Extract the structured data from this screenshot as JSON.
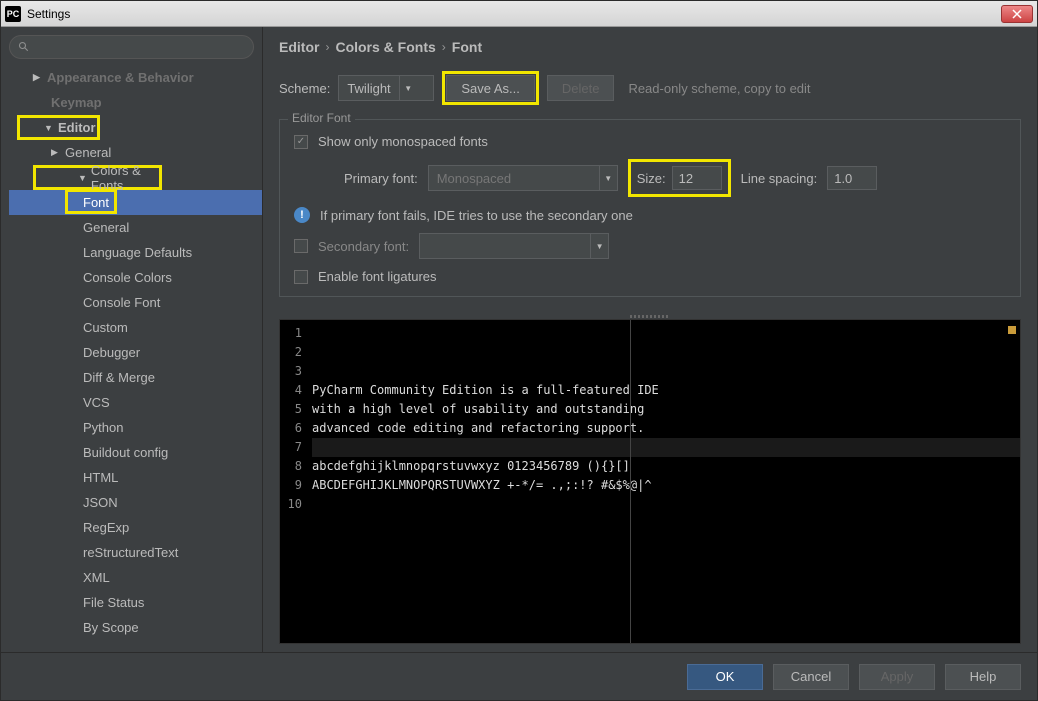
{
  "window_title": "Settings",
  "app_icon_text": "PC",
  "search_placeholder": "",
  "tree": {
    "appearance": "Appearance & Behavior",
    "keymap": "Keymap",
    "editor": "Editor",
    "general": "General",
    "colors_fonts": "Colors & Fonts",
    "font": "Font",
    "cf_general": "General",
    "lang_defaults": "Language Defaults",
    "console_colors": "Console Colors",
    "console_font": "Console Font",
    "custom": "Custom",
    "debugger": "Debugger",
    "diff_merge": "Diff & Merge",
    "vcs": "VCS",
    "python": "Python",
    "buildout": "Buildout config",
    "html": "HTML",
    "json": "JSON",
    "regexp": "RegExp",
    "rst": "reStructuredText",
    "xml": "XML",
    "file_status": "File Status",
    "by_scope": "By Scope"
  },
  "breadcrumb": {
    "a": "Editor",
    "b": "Colors & Fonts",
    "c": "Font"
  },
  "scheme": {
    "label": "Scheme:",
    "value": "Twilight",
    "save_as": "Save As...",
    "delete": "Delete",
    "hint": "Read-only scheme, copy to edit"
  },
  "editor_font": {
    "group_title": "Editor Font",
    "show_mono": "Show only monospaced fonts",
    "primary_label": "Primary font:",
    "primary_value": "Monospaced",
    "size_label": "Size:",
    "size_value": "12",
    "line_spacing_label": "Line spacing:",
    "line_spacing_value": "1.0",
    "info": "If primary font fails, IDE tries to use the secondary one",
    "secondary_label": "Secondary font:",
    "ligatures": "Enable font ligatures"
  },
  "preview_lines": [
    "PyCharm Community Edition is a full-featured IDE",
    "with a high level of usability and outstanding",
    "advanced code editing and refactoring support.",
    "",
    "abcdefghijklmnopqrstuvwxyz 0123456789 (){}[]",
    "ABCDEFGHIJKLMNOPQRSTUVWXYZ +-*/= .,;:!? #&$%@|^",
    "",
    "",
    "",
    ""
  ],
  "footer": {
    "ok": "OK",
    "cancel": "Cancel",
    "apply": "Apply",
    "help": "Help"
  }
}
